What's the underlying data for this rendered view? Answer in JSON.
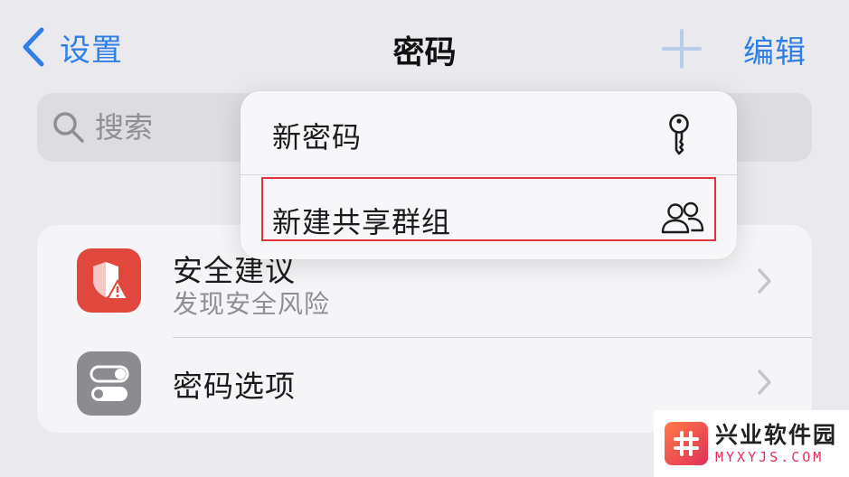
{
  "nav": {
    "back_label": "设置",
    "title": "密码",
    "edit_label": "编辑"
  },
  "search": {
    "placeholder": "搜索"
  },
  "list": {
    "items": [
      {
        "title": "安全建议",
        "subtitle": "发现安全风险",
        "icon": "shield-warning-icon",
        "icon_color": "#e0473d"
      },
      {
        "title": "密码选项",
        "icon": "toggles-icon",
        "icon_color": "#8b8b90"
      }
    ]
  },
  "menu": {
    "items": [
      {
        "label": "新密码",
        "icon": "key-icon"
      },
      {
        "label": "新建共享群组",
        "icon": "people-icon"
      }
    ]
  },
  "watermark": {
    "name": "兴业软件园",
    "domain": "MYXYJS.COM"
  },
  "colors": {
    "accent": "#2f7fe6",
    "highlight": "#e3323a"
  }
}
